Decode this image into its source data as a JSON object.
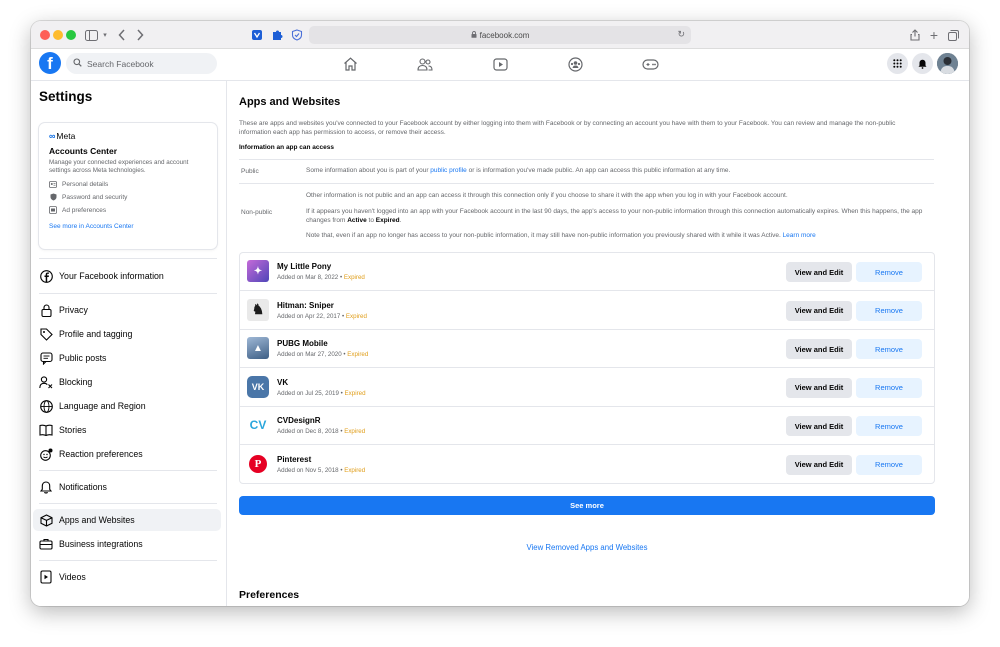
{
  "browser": {
    "url": "facebook.com"
  },
  "fb_nav": {
    "logo": "f",
    "search_placeholder": "Search Facebook",
    "center_icons": [
      "home-icon",
      "friends-icon",
      "watch-icon",
      "groups-icon",
      "gaming-icon"
    ],
    "right_icons": [
      "menu-grid-icon",
      "notifications-icon",
      "avatar"
    ]
  },
  "sidebar": {
    "title": "Settings",
    "accounts_center": {
      "brand": "Meta",
      "title": "Accounts Center",
      "description": "Manage your connected experiences and account settings across Meta technologies.",
      "items": [
        {
          "icon": "id-card-icon",
          "label": "Personal details"
        },
        {
          "icon": "shield-icon",
          "label": "Password and security"
        },
        {
          "icon": "ad-icon",
          "label": "Ad preferences"
        }
      ],
      "link": "See more in Accounts Center"
    },
    "groups": [
      [
        {
          "icon": "facebook-icon",
          "label": "Your Facebook information"
        }
      ],
      [
        {
          "icon": "lock-icon",
          "label": "Privacy"
        },
        {
          "icon": "tag-icon",
          "label": "Profile and tagging"
        },
        {
          "icon": "chat-icon",
          "label": "Public posts"
        },
        {
          "icon": "block-user-icon",
          "label": "Blocking"
        },
        {
          "icon": "globe-icon",
          "label": "Language and Region"
        },
        {
          "icon": "book-icon",
          "label": "Stories"
        },
        {
          "icon": "reaction-icon",
          "label": "Reaction preferences"
        }
      ],
      [
        {
          "icon": "bell-icon",
          "label": "Notifications"
        }
      ],
      [
        {
          "icon": "cube-icon",
          "label": "Apps and Websites",
          "active": true
        },
        {
          "icon": "briefcase-icon",
          "label": "Business integrations"
        }
      ],
      [
        {
          "icon": "video-icon",
          "label": "Videos"
        }
      ]
    ]
  },
  "main": {
    "title": "Apps and Websites",
    "intro": "These are apps and websites you've connected to your Facebook account by either logging into them with Facebook or by connecting an account you have with them to your Facebook. You can review and manage the non-public information each app has permission to access, or remove their access.",
    "info_heading": "Information an app can access",
    "public": {
      "label": "Public",
      "text_before": "Some information about you is part of your ",
      "link": "public profile",
      "text_after": " or is information you've made public. An app can access this public information at any time."
    },
    "non_public": {
      "label": "Non-public",
      "p1": "Other information is not public and an app can access it through this connection only if you choose to share it with the app when you log in with your Facebook account.",
      "p2_before": "If it appears you haven't logged into an app with your Facebook account in the last 90 days, the app's access to your non-public information through this connection automatically expires. When this happens, the app changes from ",
      "p2_active": "Active",
      "p2_mid": " to ",
      "p2_expired": "Expired",
      "p2_end": ".",
      "p3_before": "Note that, even if an app no longer has access to your non-public information, it may still have non-public information you previously shared with it while it was Active. ",
      "p3_link": "Learn more"
    },
    "apps": [
      {
        "name": "My Little Pony",
        "added": "Added on Mar 8, 2022",
        "status": "Expired",
        "icon_color": "#7b4cc2",
        "glyph": "✦"
      },
      {
        "name": "Hitman: Sniper",
        "added": "Added on Apr 22, 2017",
        "status": "Expired",
        "icon_color": "#1c1c1c",
        "glyph": "♞"
      },
      {
        "name": "PUBG Mobile",
        "added": "Added on Mar 27, 2020",
        "status": "Expired",
        "icon_color": "#5a7fa8",
        "glyph": "▲"
      },
      {
        "name": "VK",
        "added": "Added on Jul 25, 2019",
        "status": "Expired",
        "icon_color": "#4a76a8",
        "glyph": "VK"
      },
      {
        "name": "CVDesignR",
        "added": "Added on Dec 8, 2018",
        "status": "Expired",
        "icon_color": "#ffffff",
        "glyph": "CV"
      },
      {
        "name": "Pinterest",
        "added": "Added on Nov 5, 2018",
        "status": "Expired",
        "icon_color": "#ffffff",
        "glyph": "P"
      }
    ],
    "view_label": "View and Edit",
    "remove_label": "Remove",
    "see_more": "See more",
    "removed_link": "View Removed Apps and Websites",
    "preferences": "Preferences"
  }
}
